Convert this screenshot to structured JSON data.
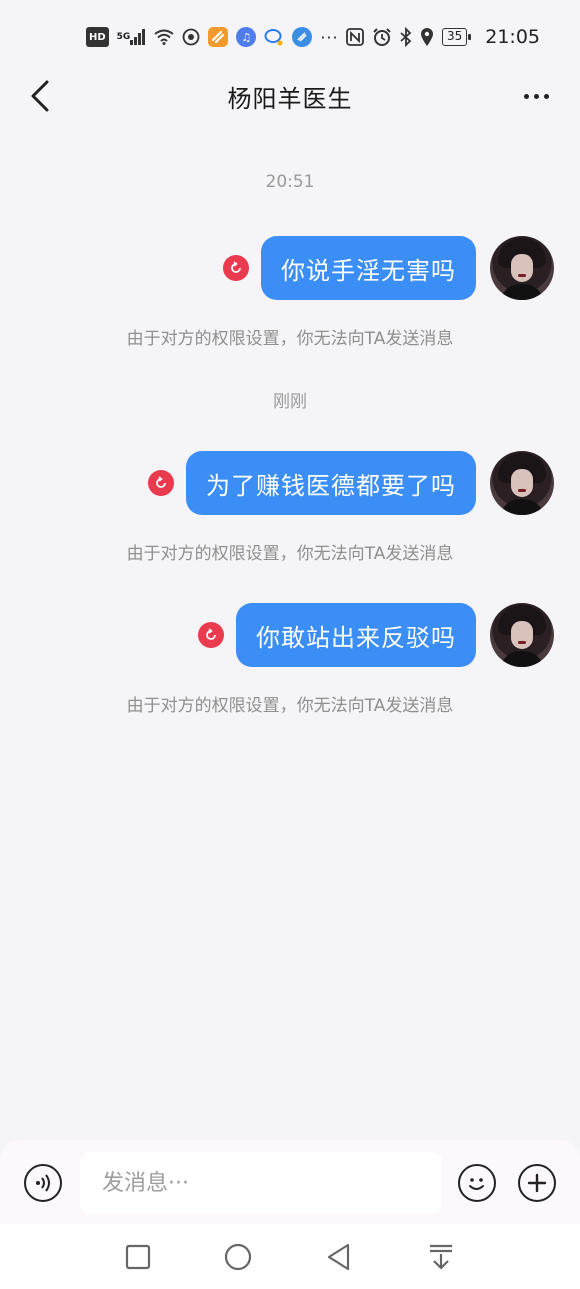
{
  "status_bar": {
    "hd": "HD",
    "signal": "5G",
    "battery": "35",
    "time": "21:05",
    "left_icons": [
      "hd-icon",
      "signal-5g-icon",
      "wifi-icon",
      "hotspot-icon",
      "app-icon-orange",
      "music-icon",
      "chat-bubble-icon",
      "browser-icon",
      "more-dots-icon"
    ],
    "right_icons": [
      "nfc-icon",
      "alarm-icon",
      "bluetooth-icon",
      "location-icon",
      "battery-icon"
    ]
  },
  "header": {
    "title": "杨阳羊医生"
  },
  "chat": {
    "timestamps": [
      "20:51",
      "刚刚"
    ],
    "messages": [
      {
        "text": "你说手淫无害吗",
        "status": "failed",
        "notice": "由于对方的权限设置，你无法向TA发送消息"
      },
      {
        "text": "为了赚钱医德都要了吗",
        "status": "failed",
        "notice": "由于对方的权限设置，你无法向TA发送消息"
      },
      {
        "text": "你敢站出来反驳吗",
        "status": "failed",
        "notice": "由于对方的权限设置，你无法向TA发送消息"
      }
    ]
  },
  "input_bar": {
    "placeholder": "发消息···"
  },
  "colors": {
    "bubble": "#3b8ef5",
    "resend": "#ea3a4d",
    "background": "#f5f4f6"
  }
}
